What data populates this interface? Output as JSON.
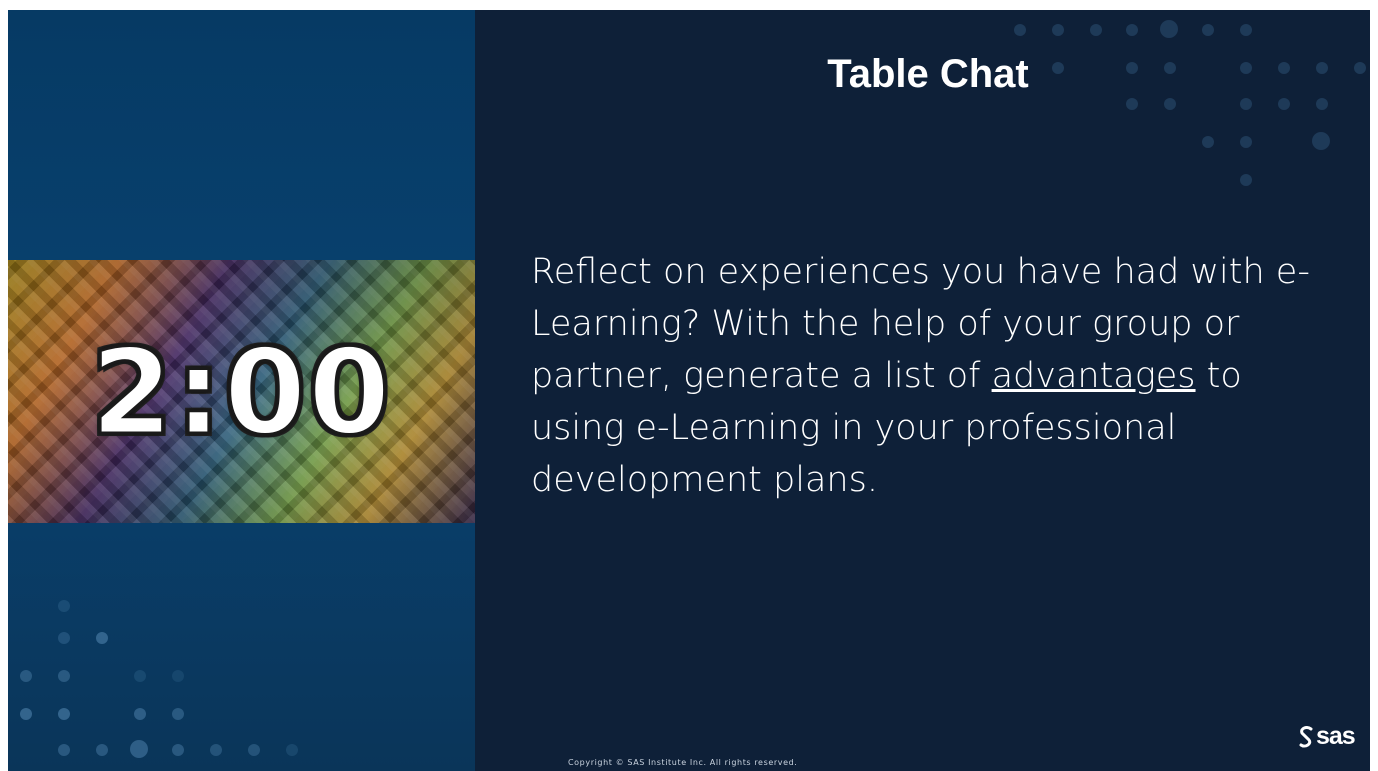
{
  "slide": {
    "title": "Table Chat",
    "timer": {
      "display": "2:00"
    },
    "body": {
      "before": "Reflect on experiences you have had with e-Learning? With the help of your group or partner, generate a list of ",
      "emphasis": "advantages",
      "after": " to using e-Learning in your professional development plans."
    },
    "footer": {
      "copyright": "Copyright © SAS Institute Inc. All rights reserved.",
      "logo_text": "sas"
    },
    "colors": {
      "background": "#0e2038",
      "left_panel": "#08406d",
      "text": "#ffffff",
      "accent_dots": "#3d6f98"
    },
    "icons": [
      "sas-logo-icon",
      "dot-pattern-decoration"
    ]
  }
}
